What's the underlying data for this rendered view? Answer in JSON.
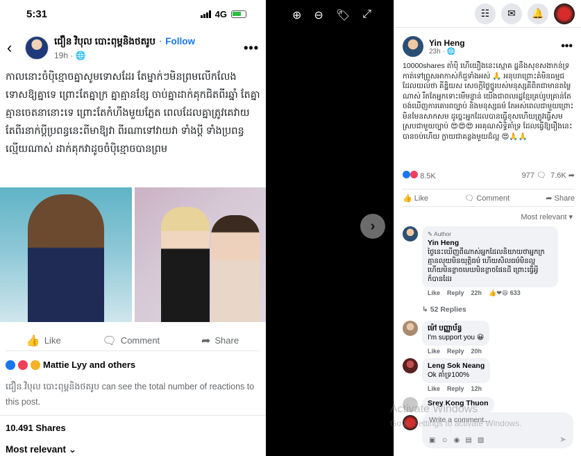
{
  "phone": {
    "status": {
      "time": "5:31",
      "network": "4G"
    },
    "post": {
      "author": "ជឿន វិបុល បោះពុម្ពនិងថតរូប",
      "follow": "Follow",
      "time": "19h",
      "text": "កាលនោះចំបុិខ្មោចគ្នាសូមទោសដែរ តែម្នាក់ៗមិនព្រមលើកលែងទោសឱ្យគ្នាទេ ព្រោះតែគ្នាក្រ គ្នាគ្មានខ្សែ ចាប់គ្នាដាក់គុកជិតពីរឆ្នាំ តែគ្នាគ្មានចេតនានោះទេ ព្រោះតែកំហឹងមួយភ្លែត ពេលដែលគ្នាត្រូវគេវាយ តែពីរនាក់ប្តីប្រពន្ធនេះពីមាឱ្យវា ពីរណាទៅវាយវា ទាំងប្តី ទាំងប្រពន្ធល្មើយណាស់ ដាក់គុកវាដូចចំបុិខ្មោចបានព្រម",
      "actions": {
        "like": "Like",
        "comment": "Comment",
        "share": "Share"
      },
      "reactions": "Mattie Lyy and others",
      "notice": "ជឿន វិបុល បោះពុម្ពនិងថតរូប can see the total number of reactions to this post.",
      "shares": "10.491 Shares",
      "most_relevant": "Most relevant ⌄"
    }
  },
  "panel": {
    "post": {
      "author": "Yin Heng",
      "time": "23h · 🌐",
      "text": "10000shares តាំបុិ ហើយឿងនេះស្មោគ ដ្ឋនឹងសុខសងាកន់ទ្រ កាត់ទៅព្រួសអាកាស់ក៏ជួទាំងអស់ 🙏 អនុបរាព្រោះគំមិនធម្មជ ដែលយល់ថា គីឌ្ឋិយស សេចក្តីថ្លៃថ្នូរបស់មនុស្សគីពិតជាមានតម្លៃណាស់ រឹតតែអ្នកទោះមើមន្ទាន់ យើងជាពលរដ្ឋខ្មែរគ្រប់រូបគ្រាន់តែចង់ឃើញការគោរពច្បាប់ និងមនុស្សធម៌ តែអស់ពេលជាមួយព្រោះមិនមែនសាកសម ដូច្នេះអ្នកដែលបានធ្វើខុសហើយត្រូវធ្វើសមស្របជាមួយច្បាប់ 😍😍😍 អរគុណសិទ្ធិគាំទ្រ ដែលធ្វើឱ្យរឿងនេះបានចប់ហើយ ក្លាយជាគន្លងមួយដ៏ល្អ 😍🙏🙏",
      "reaction_count": "8.5K",
      "comment_count": "977",
      "share_count": "7.6K",
      "actions": {
        "like": "Like",
        "comment": "Comment",
        "share": "Share"
      },
      "sort": "Most relevant ▾"
    },
    "comments": [
      {
        "tag": "Author",
        "name": "Yin Heng",
        "text": "ថ្ងៃនេះឃើញពីណាស់អ្នកដែលនិយាយថាអ្នកក្រគ្មានលុយមិនយុត្តិធម៌ ហើយសិលធម៌មិនល្អ ហើយមិនខ្លាចមេឃមិនខ្លាចផែនដី ព្រោះធ្វើអ្វីក៏បានដែរ",
        "like": "Like",
        "reply": "Reply",
        "time": "22h",
        "reactions": "633"
      },
      {
        "name": "ម៉ៅ បញ្ញាប័ន្ធ",
        "text": "I'm support you 😀",
        "like": "Like",
        "reply": "Reply",
        "time": "20h"
      },
      {
        "name": "Leng Sok Neang",
        "text": "Ok គាំទ្រ100%",
        "like": "Like",
        "reply": "Reply",
        "time": "12h"
      },
      {
        "name": "Srey Kong Thuon"
      }
    ],
    "replies": "52 Replies",
    "write_placeholder": "Write a comment..."
  },
  "watermark": {
    "line1": "Activate Windows",
    "line2": "Go to Settings to activate Windows."
  }
}
